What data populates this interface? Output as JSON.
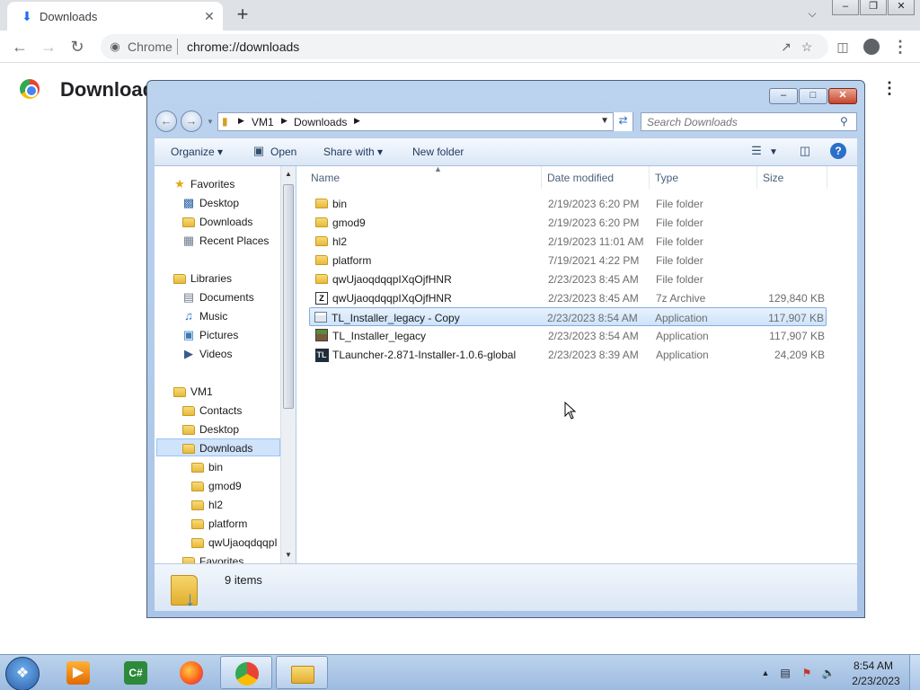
{
  "chrome": {
    "tab_title": "Downloads",
    "tab_close": "✕",
    "new_tab": "+",
    "omnibox_site": "Chrome",
    "omnibox_url": "chrome://downloads"
  },
  "page": {
    "title": "Downloads"
  },
  "explorer": {
    "breadcrumb": [
      "VM1",
      "Downloads"
    ],
    "search_placeholder": "Search Downloads",
    "commands": {
      "organize": "Organize",
      "open": "Open",
      "share_with": "Share with",
      "new_folder": "New folder"
    },
    "nav": {
      "favorites": "Favorites",
      "desktop": "Desktop",
      "downloads": "Downloads",
      "recent_places": "Recent Places",
      "libraries": "Libraries",
      "documents": "Documents",
      "music": "Music",
      "pictures": "Pictures",
      "videos": "Videos",
      "vm1": "VM1",
      "contacts": "Contacts",
      "desktop2": "Desktop",
      "downloads2": "Downloads",
      "sub_bin": "bin",
      "sub_gmod9": "gmod9",
      "sub_hl2": "hl2",
      "sub_platform": "platform",
      "sub_qw": "qwUjaoqdqqpI",
      "favorites2": "Favorites"
    },
    "columns": {
      "name": "Name",
      "date": "Date modified",
      "type": "Type",
      "size": "Size"
    },
    "files": [
      {
        "name": "bin",
        "date": "2/19/2023 6:20 PM",
        "type": "File folder",
        "size": "",
        "icon": "folder-icon"
      },
      {
        "name": "gmod9",
        "date": "2/19/2023 6:20 PM",
        "type": "File folder",
        "size": "",
        "icon": "folder-icon"
      },
      {
        "name": "hl2",
        "date": "2/19/2023 11:01 AM",
        "type": "File folder",
        "size": "",
        "icon": "folder-icon"
      },
      {
        "name": "platform",
        "date": "7/19/2021 4:22 PM",
        "type": "File folder",
        "size": "",
        "icon": "folder-icon"
      },
      {
        "name": "qwUjaoqdqqpIXqOjfHNR",
        "date": "2/23/2023 8:45 AM",
        "type": "File folder",
        "size": "",
        "icon": "folder-icon"
      },
      {
        "name": "qwUjaoqdqqpIXqOjfHNR",
        "date": "2/23/2023 8:45 AM",
        "type": "7z Archive",
        "size": "129,840 KB",
        "icon": "archive-icon"
      },
      {
        "name": "TL_Installer_legacy - Copy",
        "date": "2/23/2023 8:54 AM",
        "type": "Application",
        "size": "117,907 KB",
        "icon": "application-icon"
      },
      {
        "name": "TL_Installer_legacy",
        "date": "2/23/2023 8:54 AM",
        "type": "Application",
        "size": "117,907 KB",
        "icon": "minecraft-block-icon"
      },
      {
        "name": "TLauncher-2.871-Installer-1.0.6-global",
        "date": "2/23/2023 8:39 AM",
        "type": "Application",
        "size": "24,209 KB",
        "icon": "tlauncher-icon"
      }
    ],
    "item_count": "9 items"
  },
  "taskbar": {
    "time": "8:54 AM",
    "date": "2/23/2023"
  }
}
